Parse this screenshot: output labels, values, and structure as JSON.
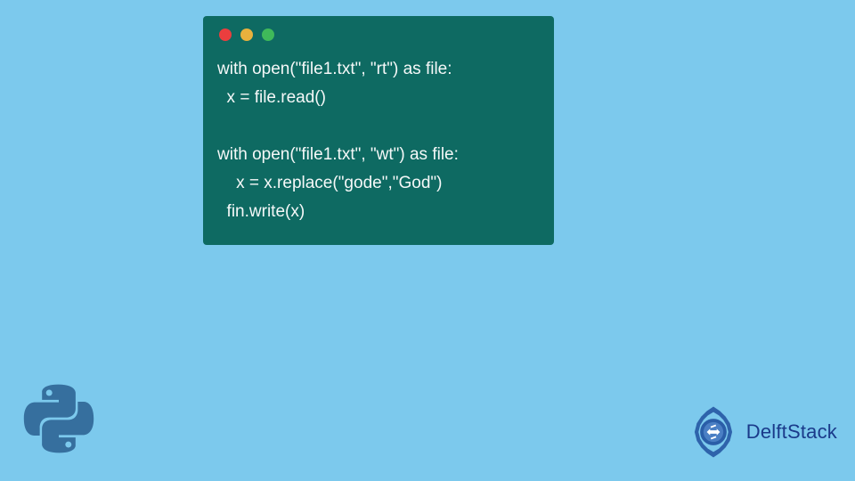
{
  "code": {
    "line1": "with open(\"file1.txt\", \"rt\") as file:",
    "line2": "  x = file.read()",
    "line3": "  ",
    "line4": "with open(\"file1.txt\", \"wt\") as file:",
    "line5": "    x = x.replace(\"gode\",\"God\")",
    "line6": "  fin.write(x)"
  },
  "brand": {
    "name": "DelftStack"
  },
  "colors": {
    "background": "#7cc9ed",
    "window": "#0e6a62",
    "text": "#f5f8f8",
    "brand": "#1a3a8a",
    "dot_red": "#eb3e3e",
    "dot_yellow": "#e8b13d",
    "dot_green": "#3fb95a"
  }
}
